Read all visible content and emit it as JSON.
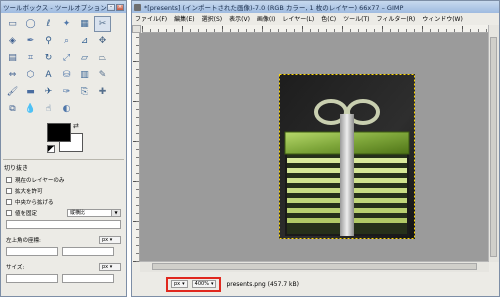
{
  "toolbox": {
    "title": "ツールボックス - ツールオプション",
    "tools": [
      "rect-select-icon",
      "ellipse-select-icon",
      "free-select-icon",
      "fuzzy-select-icon",
      "select-by-color-icon",
      "scissors-icon",
      "foreground-select-icon",
      "paths-icon",
      "color-picker-icon",
      "zoom-icon",
      "measure-icon",
      "move-icon",
      "align-icon",
      "crop-icon",
      "rotate-icon",
      "scale-icon",
      "shear-icon",
      "perspective-icon",
      "flip-icon",
      "cage-transform-icon",
      "text-icon",
      "bucket-fill-icon",
      "blend-icon",
      "pencil-icon",
      "paintbrush-icon",
      "eraser-icon",
      "airbrush-icon",
      "ink-icon",
      "clone-icon",
      "heal-icon",
      "perspective-clone-icon",
      "blur-icon",
      "smudge-icon",
      "dodge-burn-icon"
    ],
    "active_tool": 5,
    "options": {
      "heading": "切り抜き",
      "checkboxes": [
        "現在のレイヤーのみ",
        "拡大を許可",
        "中央から拡げる",
        "値を固定"
      ],
      "fixed_combo": "縦横比",
      "position_label": "左上角の座標:",
      "size_label": "サイズ:",
      "unit": "px"
    }
  },
  "image_window": {
    "title": "*[presents] (インポートされた画像)-7.0 (RGB カラー, 1 枚のレイヤー) 66x77 – GIMP",
    "menu": [
      "ファイル(F)",
      "編集(E)",
      "選択(S)",
      "表示(V)",
      "画像(I)",
      "レイヤー(L)",
      "色(C)",
      "ツール(T)",
      "フィルター(R)",
      "ウィンドウ(W)"
    ],
    "status": {
      "unit": "px",
      "zoom": "400%",
      "file": "presents.png (457.7 kB)"
    }
  },
  "colors": {
    "highlight": "#e0281e",
    "canvas": "#9b9b9b",
    "gift_dark": "#2b2b2b",
    "gift_green": "#7ea63a"
  }
}
